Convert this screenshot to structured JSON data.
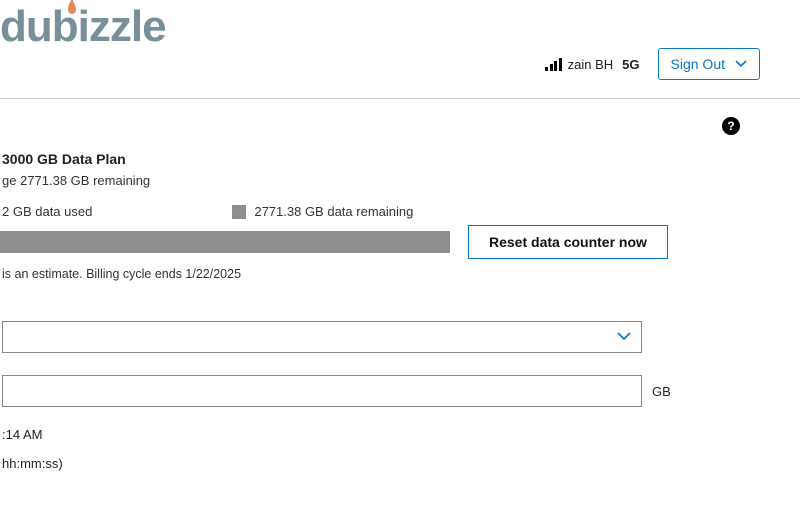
{
  "watermark": "dubizzle",
  "header": {
    "carrier": "zain BH",
    "network": "5G",
    "signout_label": "Sign Out"
  },
  "plan": {
    "title_fragment": "3000 GB Data Plan",
    "subtitle_fragment": "ge 2771.38 GB remaining"
  },
  "usage": {
    "used_fragment": "2 GB data used",
    "remaining_label": "2771.38 GB data remaining"
  },
  "reset_label": "Reset data counter now",
  "estimate_fragment": " is an estimate. Billing cycle ends 1/22/2025",
  "fields": {
    "gb_unit": "GB",
    "time_fragment": ":14 AM",
    "format_fragment": "hh:mm:ss)"
  }
}
